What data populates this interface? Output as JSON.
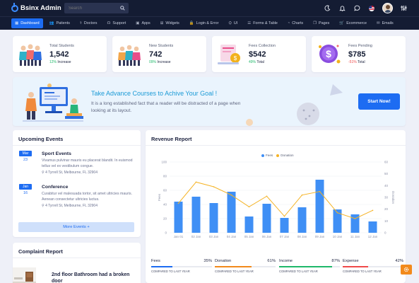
{
  "app": {
    "title": "Bsinx Admin"
  },
  "search": {
    "placeholder": "Search"
  },
  "nav": [
    {
      "label": "Dashboard",
      "icon": "dashboard-icon",
      "glyph": "▦",
      "active": true
    },
    {
      "label": "Patients",
      "icon": "patients-icon",
      "glyph": "👥",
      "active": false
    },
    {
      "label": "Doctors",
      "icon": "doctors-icon",
      "glyph": "⚕",
      "active": false
    },
    {
      "label": "Support",
      "icon": "support-icon",
      "glyph": "☊",
      "active": false
    },
    {
      "label": "Apps",
      "icon": "apps-icon",
      "glyph": "▣",
      "active": false
    },
    {
      "label": "Widgets",
      "icon": "widgets-icon",
      "glyph": "⊞",
      "active": false
    },
    {
      "label": "Login & Error",
      "icon": "lock-icon",
      "glyph": "🔒",
      "active": false
    },
    {
      "label": "UI",
      "icon": "ui-icon",
      "glyph": "⛭",
      "active": false
    },
    {
      "label": "Forms & Table",
      "icon": "forms-icon",
      "glyph": "☰",
      "active": false
    },
    {
      "label": "Charts",
      "icon": "charts-icon",
      "glyph": "◔",
      "active": false
    },
    {
      "label": "Pages",
      "icon": "pages-icon",
      "glyph": "❐",
      "active": false
    },
    {
      "label": "Ecommerce",
      "icon": "cart-icon",
      "glyph": "🛒",
      "active": false
    },
    {
      "label": "Emails",
      "icon": "mail-icon",
      "glyph": "✉",
      "active": false
    }
  ],
  "stats": [
    {
      "label": "Total Students",
      "value": "1,542",
      "change": "12%",
      "change_text": "Increase",
      "direction": "up"
    },
    {
      "label": "New Students",
      "value": "742",
      "change": "09%",
      "change_text": "Increase",
      "direction": "up"
    },
    {
      "label": "Fees Collection",
      "value": "$542",
      "change": "49%",
      "change_text": "Total",
      "direction": "up"
    },
    {
      "label": "Fees Pending",
      "value": "$785",
      "change": "-51%",
      "change_text": "Total",
      "direction": "down"
    }
  ],
  "banner": {
    "title": "Take Advance Courses to Achive Your Goal !",
    "description": "It is a long established fact that a reader will be distracted of a page when looking at its layout.",
    "button": "Start Now!"
  },
  "events": {
    "title": "Upcoming Events",
    "items": [
      {
        "month": "Mar",
        "day": "23",
        "title": "Sport Events",
        "description": "Vivamus pulvinar mauris eu placerat blandit. In euismod tellus vel ex vestibulum congue.",
        "location": "4 Tyrrell St, Melbourne, FL 32904"
      },
      {
        "month": "Jan",
        "day": "16",
        "title": "Conference",
        "description": "Curabitur vel malesuada tortor, sit amet ultricies mauris. Aenean consectetur ultricies luctus.",
        "location": "4 Tyrrell St, Melbourne, FL 32904"
      }
    ],
    "more_button": "More Events +"
  },
  "revenue": {
    "title": "Revenue Report"
  },
  "chart_data": {
    "type": "bar",
    "title": "Revenue Report",
    "categories": [
      "Jan 01",
      "02 Jan",
      "03 Jan",
      "04 Jan",
      "05 Jan",
      "06 Jan",
      "07 Jan",
      "08 Jan",
      "09 Jan",
      "10 Jan",
      "11 Jan",
      "12 Jan"
    ],
    "ylabel": "Fees",
    "y2label": "Donation",
    "ylim": [
      0,
      100
    ],
    "y2lim": [
      0,
      60
    ],
    "yticks": [
      0,
      20,
      40,
      60,
      80,
      100
    ],
    "y2ticks": [
      0,
      10,
      20,
      30,
      40,
      50,
      60
    ],
    "series": [
      {
        "name": "Fees",
        "type": "bar",
        "axis": "left",
        "color": "#3f8ff5",
        "values": [
          44,
          51,
          42,
          58,
          23,
          41,
          21,
          36,
          75,
          33,
          26,
          16
        ]
      },
      {
        "name": "Donation",
        "type": "line",
        "axis": "right",
        "color": "#f5b324",
        "values": [
          25,
          43,
          39,
          32,
          22,
          31,
          14,
          32,
          35,
          17,
          12,
          19
        ]
      }
    ],
    "legend": "top-center",
    "grid": true
  },
  "summary": [
    {
      "label": "Fees",
      "percent": "35%",
      "fill": 0.35,
      "color": "#1d6cf2",
      "compare": "COMPARED TO LAST YEAR"
    },
    {
      "label": "Donation",
      "percent": "61%",
      "fill": 0.61,
      "color": "#f28a1c",
      "compare": "COMPARED TO LAST YEAR"
    },
    {
      "label": "Income",
      "percent": "87%",
      "fill": 0.87,
      "color": "#1fb86a",
      "compare": "COMPARED TO LAST YEAR"
    },
    {
      "label": "Expense",
      "percent": "42%",
      "fill": 0.42,
      "color": "#ef4a4a",
      "compare": "COMPARED TO LAST YEAR"
    }
  ],
  "complaints": {
    "title": "Complaint Report",
    "items": [
      {
        "title": "2nd floor Bathroom had a broken door"
      }
    ]
  },
  "colors": {
    "accent": "#1d6cf2",
    "nav_bg": "#141c33",
    "banner_title": "#1a9ad6",
    "page_bg": "#eef0f8"
  }
}
